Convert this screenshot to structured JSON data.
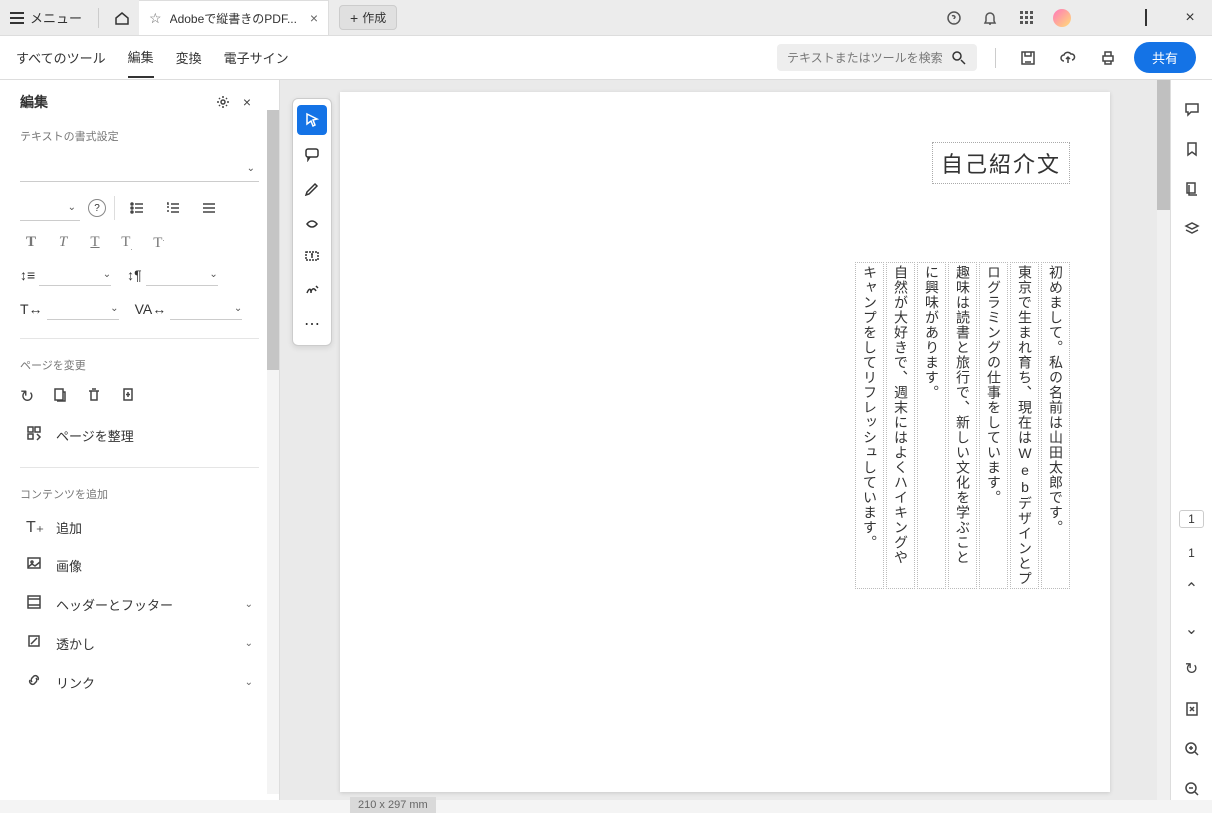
{
  "titlebar": {
    "menu_label": "メニュー",
    "tab_title": "Adobeで縦書きのPDF...",
    "create_label": "作成"
  },
  "toolbar": {
    "all_tools": "すべてのツール",
    "edit": "編集",
    "convert": "変換",
    "esign": "電子サイン",
    "search_placeholder": "テキストまたはツールを検索",
    "share": "共有"
  },
  "sidebar": {
    "title": "編集",
    "text_format_label": "テキストの書式設定",
    "change_page_label": "ページを変更",
    "organize_label": "ページを整理",
    "add_content_label": "コンテンツを追加",
    "items": {
      "add": "追加",
      "image": "画像",
      "header_footer": "ヘッダーとフッター",
      "watermark": "透かし",
      "link": "リンク"
    }
  },
  "document": {
    "title": "自己紹介文",
    "page_dim": "210 x 297 mm",
    "columns": [
      "初めまして。私の名前は山田太郎です。",
      "東京で生まれ育ち、現在はWebデザインとプ",
      "ログラミングの仕事をしています。",
      "趣味は読書と旅行で、新しい文化を学ぶこと",
      "に興味があります。",
      "自然が大好きで、週末にはよくハイキングや",
      "キャンプをしてリフレッシュしています。"
    ]
  },
  "rightrail": {
    "page_current": "1",
    "page_total": "1"
  }
}
